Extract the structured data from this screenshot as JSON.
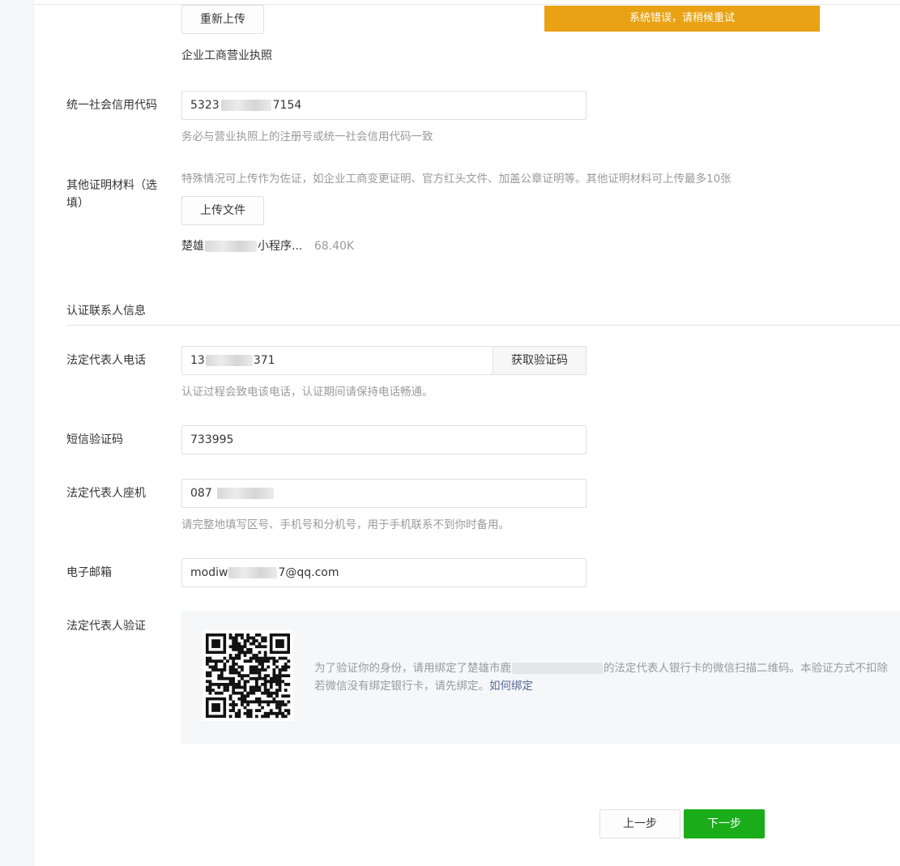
{
  "toast": {
    "message": "系统错误，请稍候重试"
  },
  "license": {
    "reupload_label": "重新上传",
    "file_name": "企业工商营业执照"
  },
  "credit_code": {
    "label": "统一社会信用代码",
    "value_prefix": "5323",
    "value_suffix": "7154",
    "hint": "务必与营业执照上的注册号或统一社会信用代码一致"
  },
  "other_docs": {
    "label": "其他证明材料（选填）",
    "hint": "特殊情况可上传作为佐证，如企业工商变更证明、官方红头文件、加盖公章证明等。其他证明材料可上传最多10张",
    "upload_label": "上传文件",
    "file_name_prefix": "楚雄",
    "file_name_suffix": "小程序...",
    "file_size": "68.40K"
  },
  "contact_section": {
    "title": "认证联系人信息"
  },
  "phone": {
    "label": "法定代表人电话",
    "value_prefix": "13",
    "value_suffix": "371",
    "code_button": "获取验证码",
    "hint": "认证过程会致电该电话，认证期间请保持电话畅通。"
  },
  "sms": {
    "label": "短信验证码",
    "value": "733995"
  },
  "landline": {
    "label": "法定代表人座机",
    "value_prefix": "087",
    "hint": "请完整地填写区号、手机号和分机号，用于手机联系不到你时备用。"
  },
  "email": {
    "label": "电子邮箱",
    "value_prefix": "modiw",
    "value_suffix": "7@qq.com"
  },
  "legal_verify": {
    "label": "法定代表人验证",
    "text_line1_prefix": "为了验证你的身份，请用绑定了楚雄市鹿",
    "text_line1_suffix": "的法定代表人银行卡的微信扫描二维码。本验证方式不扣除",
    "text_line2": "若微信没有绑定银行卡，请先绑定。",
    "link": "如何绑定",
    "qr_icon": "qr-code-icon"
  },
  "footer": {
    "prev_label": "上一步",
    "next_label": "下一步"
  },
  "colors": {
    "primary": "#1aad19",
    "toast": "#e9a214",
    "link": "#576b95",
    "hint": "#9a9a9a"
  }
}
